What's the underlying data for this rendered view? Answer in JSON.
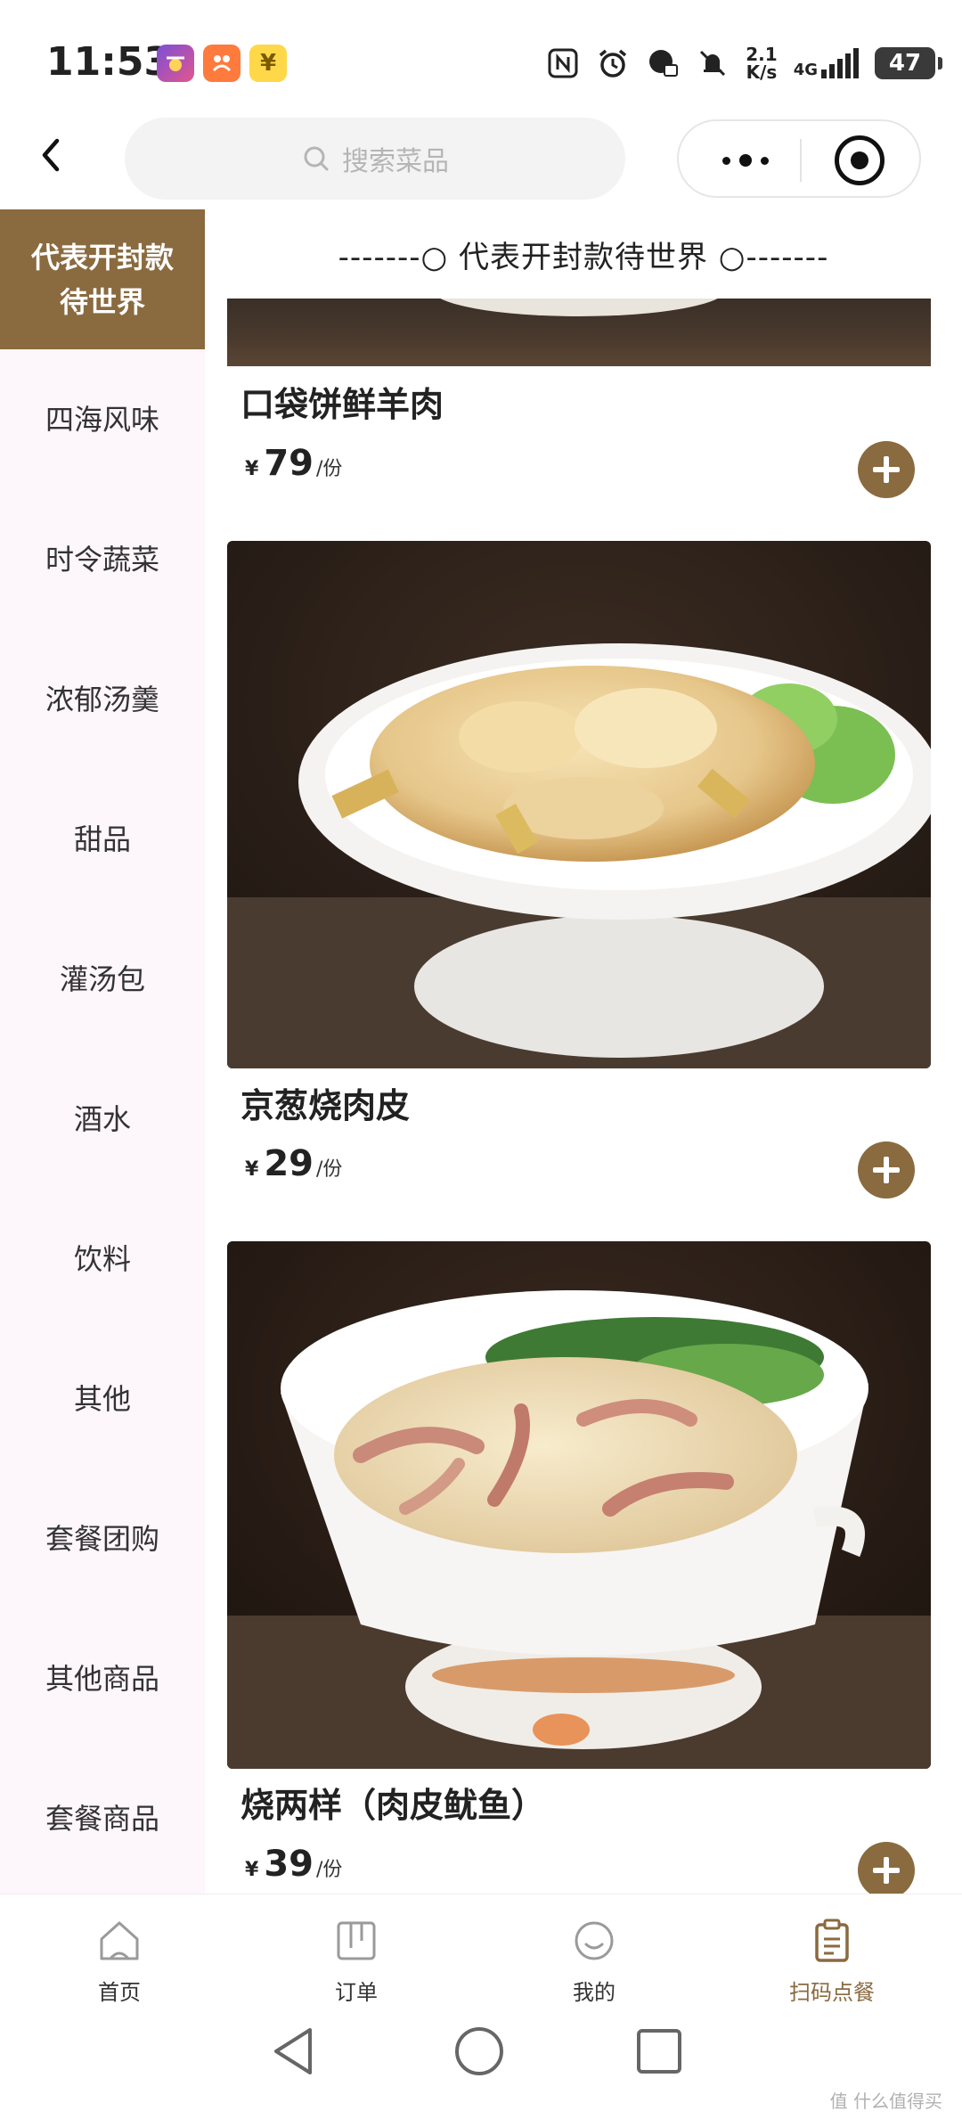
{
  "status_bar": {
    "time": "11:53",
    "net_speed_value": "2.1",
    "net_speed_unit": "K/s",
    "network": "4G",
    "battery": "47"
  },
  "nav": {
    "search_placeholder": "搜索菜品"
  },
  "sidebar": {
    "items": [
      {
        "label": "代表开封款待世界",
        "active": true
      },
      {
        "label": "四海风味"
      },
      {
        "label": "时令蔬菜"
      },
      {
        "label": "浓郁汤羹"
      },
      {
        "label": "甜品"
      },
      {
        "label": "灌汤包"
      },
      {
        "label": "酒水"
      },
      {
        "label": "饮料"
      },
      {
        "label": "其他"
      },
      {
        "label": "套餐团购"
      },
      {
        "label": "其他商品"
      },
      {
        "label": "套餐商品"
      }
    ]
  },
  "menu": {
    "section_title": "-------○ 代表开封款待世界 ○-------",
    "dishes": [
      {
        "name": "口袋饼鲜羊肉",
        "currency": "¥",
        "price": "79",
        "unit": "/份"
      },
      {
        "name": "京葱烧肉皮",
        "currency": "¥",
        "price": "29",
        "unit": "/份"
      },
      {
        "name": "烧两样（肉皮鱿鱼）",
        "currency": "¥",
        "price": "39",
        "unit": "/份"
      }
    ]
  },
  "tabbar": {
    "tabs": [
      {
        "label": "首页"
      },
      {
        "label": "订单"
      },
      {
        "label": "我的"
      },
      {
        "label": "扫码点餐",
        "active": true
      }
    ]
  },
  "watermark": "值 什么值得买",
  "colors": {
    "accent": "#8a6a3f",
    "sidebar_bg": "#fdf6fb",
    "search_bg": "#f3f3f3"
  }
}
